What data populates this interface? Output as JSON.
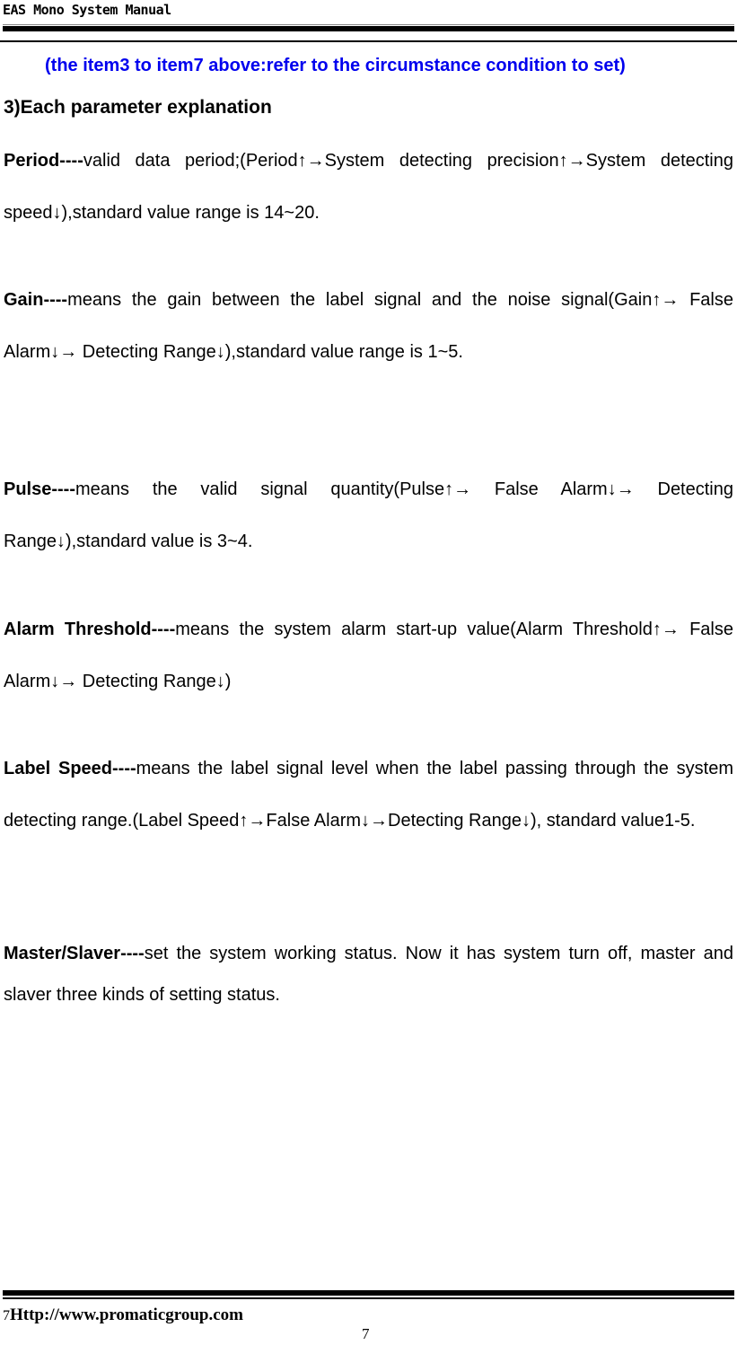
{
  "header": {
    "title": "EAS Mono System Manual"
  },
  "note": "(the item3 to item7 above:refer to the circumstance condition to set)",
  "section_title": "3)Each parameter explanation",
  "parameters": [
    {
      "term": "Period----",
      "text": "valid data period;(Period↑→System detecting precision↑→System detecting speed↓),standard value range is 14~20."
    },
    {
      "term": "Gain----",
      "text": "means the gain between the label signal and the noise signal(Gain↑→ False Alarm↓→ Detecting Range↓),standard value range is 1~5."
    },
    {
      "term": "Pulse----",
      "text": "means the valid signal quantity(Pulse↑→ False Alarm↓→ Detecting Range↓),standard value is 3~4."
    },
    {
      "term": "Alarm Threshold----",
      "text": "means the system alarm start-up value(Alarm Threshold↑→ False Alarm↓→ Detecting Range↓)"
    },
    {
      "term": "Label Speed----",
      "text": "means the label signal level when the label passing through the system detecting range.(Label Speed↑→False Alarm↓→Detecting Range↓), standard value1-5."
    },
    {
      "term": "Master/Slaver----",
      "text": "set the system working status. Now it has system turn off, master and slaver three kinds of setting status."
    }
  ],
  "footer": {
    "page_prefix": "7",
    "url": "Http://www.promaticgroup.com",
    "page_number": "7"
  }
}
